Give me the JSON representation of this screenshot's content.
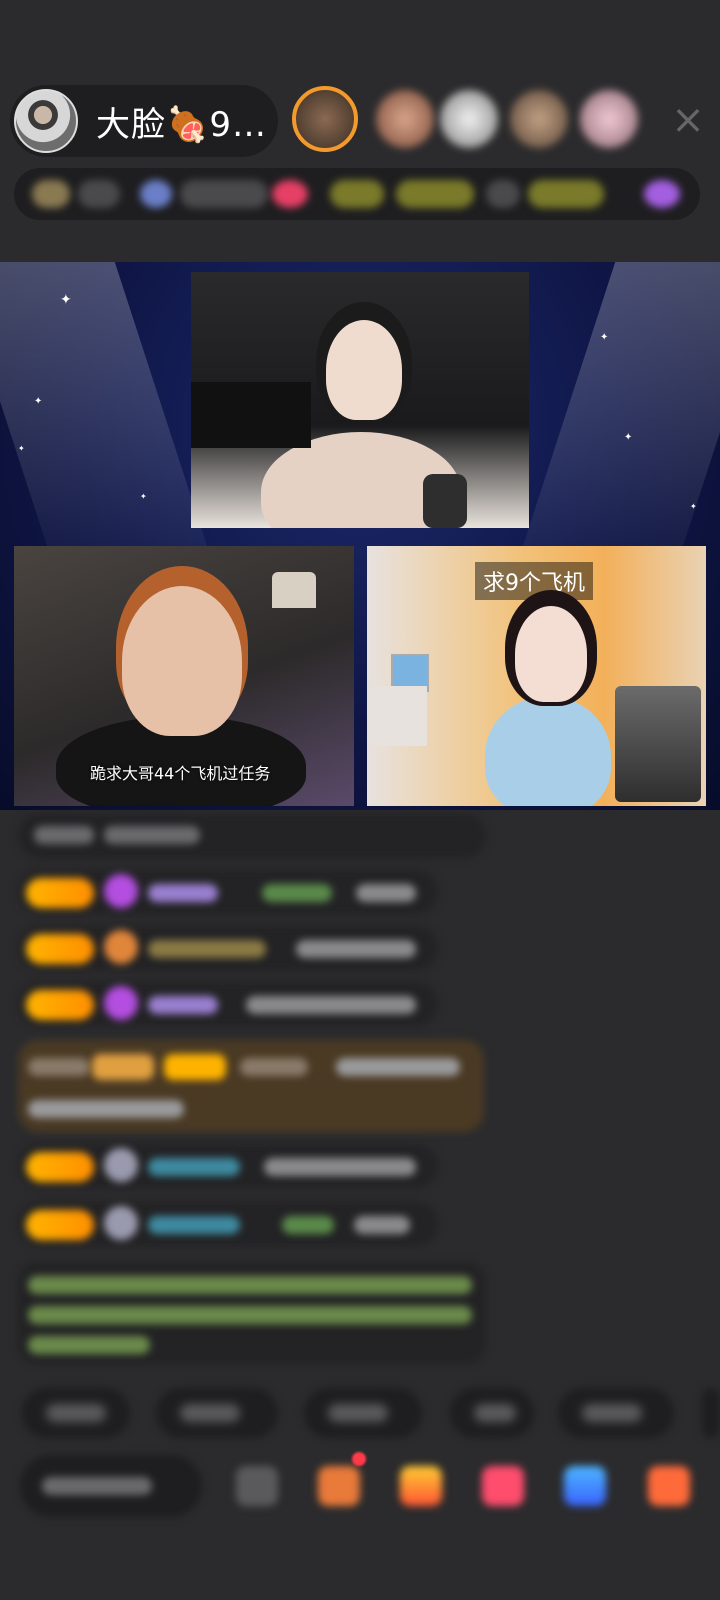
{
  "header": {
    "host_name": "大脸🍖9…",
    "close_icon": "×"
  },
  "stage": {
    "left_caption": "跪求大哥44个飞机过任务",
    "right_caption": "求9个飞机"
  },
  "colors": {
    "background": "#2b2b2d",
    "stage_dark": "#0f1646",
    "badge_gold": "#ffb300",
    "accent_orange": "#f39a2c"
  }
}
